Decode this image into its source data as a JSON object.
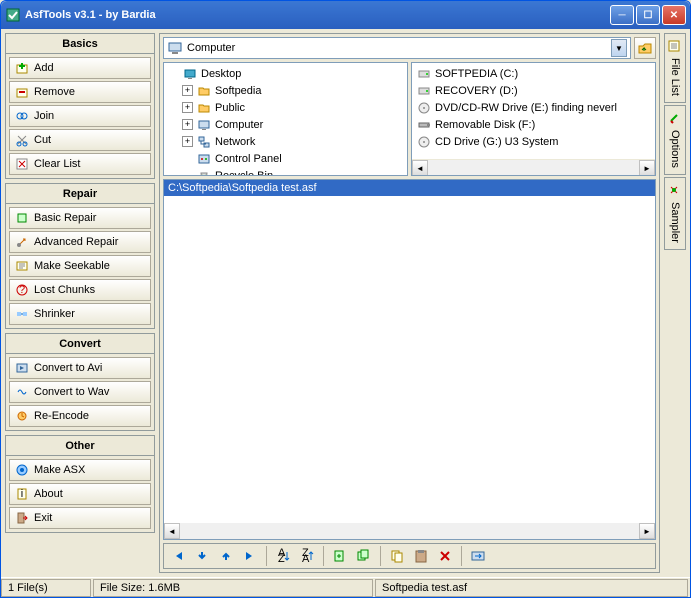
{
  "window": {
    "title": "AsfTools v3.1 - by Bardia"
  },
  "sidebar": {
    "sections": [
      {
        "title": "Basics",
        "items": [
          {
            "label": "Add",
            "icon": "add"
          },
          {
            "label": "Remove",
            "icon": "remove"
          },
          {
            "label": "Join",
            "icon": "join"
          },
          {
            "label": "Cut",
            "icon": "cut"
          },
          {
            "label": "Clear List",
            "icon": "clear"
          }
        ]
      },
      {
        "title": "Repair",
        "items": [
          {
            "label": "Basic Repair",
            "icon": "basic-repair"
          },
          {
            "label": "Advanced Repair",
            "icon": "adv-repair"
          },
          {
            "label": "Make Seekable",
            "icon": "seekable"
          },
          {
            "label": "Lost Chunks",
            "icon": "lost"
          },
          {
            "label": "Shrinker",
            "icon": "shrink"
          }
        ]
      },
      {
        "title": "Convert",
        "items": [
          {
            "label": "Convert to Avi",
            "icon": "avi"
          },
          {
            "label": "Convert to Wav",
            "icon": "wav"
          },
          {
            "label": "Re-Encode",
            "icon": "reencode"
          }
        ]
      },
      {
        "title": "Other",
        "items": [
          {
            "label": "Make ASX",
            "icon": "asx"
          },
          {
            "label": "About",
            "icon": "about"
          },
          {
            "label": "Exit",
            "icon": "exit"
          }
        ]
      }
    ]
  },
  "path": {
    "current": "Computer"
  },
  "tree": [
    {
      "label": "Desktop",
      "expandable": false,
      "icon": "desktop"
    },
    {
      "label": "Softpedia",
      "expandable": true,
      "icon": "folder"
    },
    {
      "label": "Public",
      "expandable": true,
      "icon": "folder"
    },
    {
      "label": "Computer",
      "expandable": true,
      "icon": "computer"
    },
    {
      "label": "Network",
      "expandable": true,
      "icon": "network"
    },
    {
      "label": "Control Panel",
      "expandable": false,
      "icon": "control"
    },
    {
      "label": "Recycle Bin",
      "expandable": false,
      "icon": "recycle"
    }
  ],
  "drives": [
    {
      "label": "SOFTPEDIA (C:)",
      "icon": "hdd"
    },
    {
      "label": "RECOVERY (D:)",
      "icon": "hdd"
    },
    {
      "label": "DVD/CD-RW Drive (E:) finding neverl",
      "icon": "cd"
    },
    {
      "label": "Removable Disk (F:)",
      "icon": "usb"
    },
    {
      "label": "CD Drive (G:) U3 System",
      "icon": "cd"
    }
  ],
  "files": [
    {
      "path": "C:\\Softpedia\\Softpedia test.asf",
      "selected": true
    }
  ],
  "right_tabs": [
    {
      "label": "File List",
      "icon": "filelist"
    },
    {
      "label": "Options",
      "icon": "options"
    },
    {
      "label": "Sampler",
      "icon": "sampler"
    }
  ],
  "status": {
    "count": "1 File(s)",
    "size": "File Size: 1.6MB",
    "name": "Softpedia test.asf"
  },
  "toolbar_icons": [
    "first",
    "down",
    "up",
    "last",
    "sep",
    "sort-asc",
    "sort-desc",
    "sep",
    "add-file",
    "add-many",
    "sep",
    "copy",
    "paste",
    "delete",
    "sep",
    "process"
  ]
}
